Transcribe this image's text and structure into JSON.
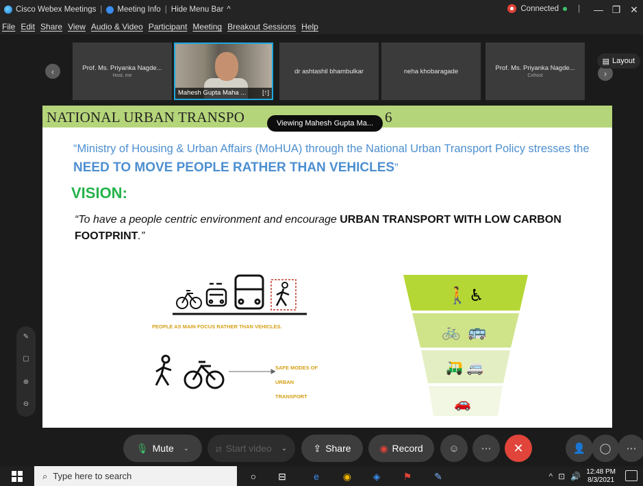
{
  "titlebar": {
    "app_name": "Cisco Webex Meetings",
    "meeting_info": "Meeting Info",
    "hide_menu": "Hide Menu Bar",
    "status": "Connected"
  },
  "menubar": {
    "items": [
      "File",
      "Edit",
      "Share",
      "View",
      "Audio & Video",
      "Participant",
      "Meeting",
      "Breakout Sessions",
      "Help"
    ]
  },
  "participants": [
    {
      "name": "Prof. Ms. Priyanka Nagde...",
      "sub": "Host, me"
    },
    {
      "name": "Mahesh Gupta Maha ...",
      "sub": ""
    },
    {
      "name": "dr ashtashil bhambulkar",
      "sub": ""
    },
    {
      "name": "neha khobaragade",
      "sub": ""
    },
    {
      "name": "Prof. Ms. Priyanka Nagde...",
      "sub": "Cohost"
    }
  ],
  "layout_label": "Layout",
  "tooltip": "Viewing Mahesh Gupta Ma...",
  "slide": {
    "title": "NATIONAL URBAN TRANSPORT POLICY 2006",
    "title_visible": "NATIONAL URBAN TRANSPO",
    "title_tail": "6",
    "quote1_pre": "“Ministry of Housing & Urban Affairs (MoHUA) through the National  Urban Transport Policy stresses the ",
    "quote1_bold": "NEED TO MOVE PEOPLE  RATHER THAN VEHICLES",
    "quote1_post": "”",
    "vision": "VISION:",
    "quote2_pre": "“To have a people centric environment and encourage ",
    "quote2_bold": "URBAN  TRANSPORT WITH LOW CARBON FOOTPRINT",
    "quote2_post": ".”",
    "focus_label": "PEOPLE AS MAIN FOCUS RATHER THAN VEHICLES.",
    "safe_label_1": "SAFE   MODES OF",
    "safe_label_2": "URBAN",
    "safe_label_3": "TRANSPORT"
  },
  "controls": {
    "mute": "Mute",
    "start_video": "Start video",
    "share": "Share",
    "record": "Record"
  },
  "taskbar": {
    "search_placeholder": "Type here to search",
    "time": "12:48 PM",
    "date": "8/3/2021"
  },
  "colors": {
    "accent_blue": "#4d8fd0",
    "vision_green": "#25b34a",
    "header_green": "#b5d57a",
    "leave_red": "#e0443a",
    "video_border": "#1ea8e0"
  }
}
